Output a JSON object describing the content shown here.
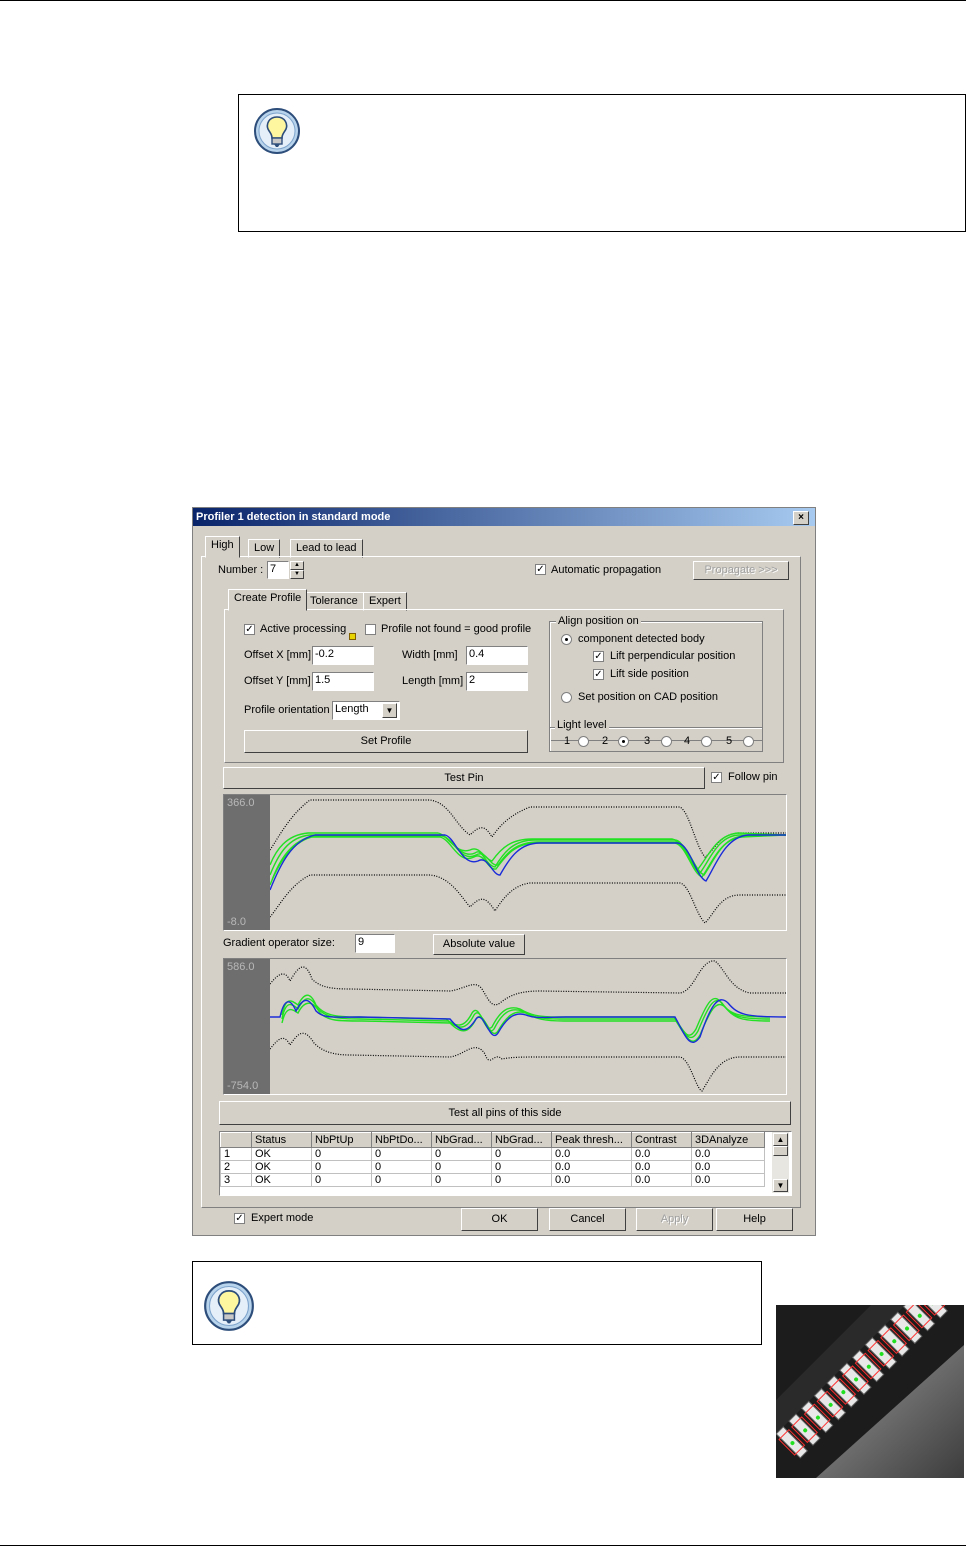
{
  "dialog": {
    "title": "Profiler 1 detection in standard mode",
    "close_label": "×",
    "tabs": [
      "High",
      "Low",
      "Lead to lead"
    ],
    "number_label": "Number :",
    "number_value": "7",
    "auto_propagation_label": "Automatic propagation",
    "auto_propagation_checked": true,
    "propagate_label": "Propagate >>>",
    "subtabs": [
      "Create Profile",
      "Tolerance",
      "Expert"
    ],
    "active_processing_label": "Active processing",
    "profile_not_found_label": "Profile not found = good profile",
    "offset_x_label": "Offset X [mm]",
    "offset_x_value": "-0.2",
    "offset_y_label": "Offset Y [mm]",
    "offset_y_value": "1.5",
    "width_label": "Width [mm]",
    "width_value": "0.4",
    "length_label": "Length [mm]",
    "length_value": "2",
    "orientation_label": "Profile orientation",
    "orientation_value": "Length",
    "set_profile_label": "Set Profile",
    "align_group_label": "Align position on",
    "align_body_label": "component detected body",
    "lift_perp_label": "Lift perpendicular position",
    "lift_side_label": "Lift side position",
    "set_cad_label": "Set position on CAD position",
    "light_group_label": "Light level",
    "light_levels": [
      "1",
      "2",
      "3",
      "4",
      "5"
    ],
    "light_selected": 3,
    "test_pin_label": "Test Pin",
    "follow_pin_label": "Follow pin",
    "plot1_max": "366.0",
    "plot1_min": "-8.0",
    "gradient_label": "Gradient operator size:",
    "gradient_value": "9",
    "absolute_value_label": "Absolute value",
    "plot2_max": "586.0",
    "plot2_min": "-754.0",
    "test_all_label": "Test all pins of this side",
    "table_headers": [
      "",
      "Status",
      "NbPtUp",
      "NbPtDo...",
      "NbGrad...",
      "NbGrad...",
      "Peak thresh...",
      "Contrast",
      "3DAnalyze"
    ],
    "table_rows": [
      [
        "1",
        "OK",
        "0",
        "0",
        "0",
        "0",
        "0.0",
        "0.0",
        "0.0"
      ],
      [
        "2",
        "OK",
        "0",
        "0",
        "0",
        "0",
        "0.0",
        "0.0",
        "0.0"
      ],
      [
        "3",
        "OK",
        "0",
        "0",
        "0",
        "0",
        "0.0",
        "0.0",
        "0.0"
      ]
    ],
    "expert_mode_label": "Expert mode",
    "ok_label": "OK",
    "cancel_label": "Cancel",
    "apply_label": "Apply",
    "help_label": "Help",
    "check_mark": "✓"
  },
  "colors": {
    "profile_green": "#22e022",
    "profile_blue": "#1a2bd8",
    "tolerance_black": "#000000"
  },
  "icons": [
    "lightbulb-icon",
    "close-icon",
    "spin-up-icon",
    "spin-down-icon",
    "dropdown-arrow-icon"
  ]
}
